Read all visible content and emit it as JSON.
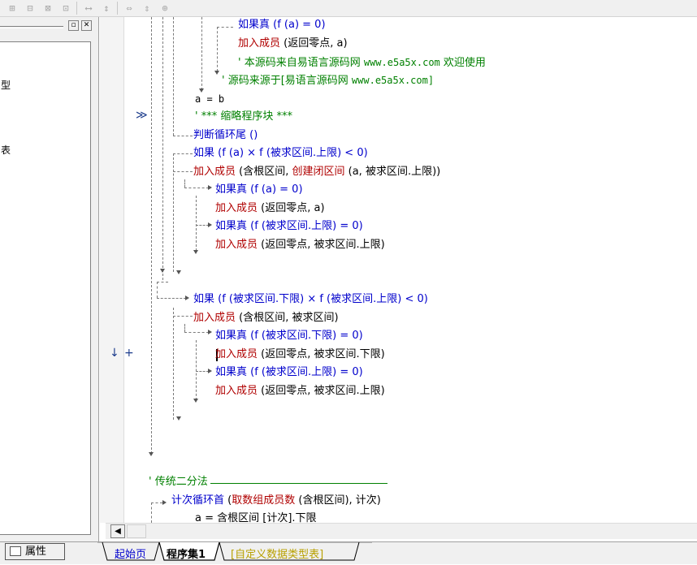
{
  "toolbar": {
    "icons": [
      "align-left-icon",
      "align-center-icon",
      "align-right-icon",
      "align-distribute-icon",
      "space-h-icon",
      "space-v-icon",
      "same-width-icon",
      "same-height-icon",
      "same-size-icon"
    ]
  },
  "left_panel": {
    "tree_fragments": [
      "型",
      "表"
    ]
  },
  "code": {
    "l1": "如果真 (f (a) = 0)",
    "l2a": "加入成员",
    "l2b": " (返回零点, a)",
    "l3a": "' 本源码来自易语言源码网 ",
    "l3b": "www.e5a5x.com",
    "l3c": "  欢迎使用",
    "l4a": "' 源码来源于[易语言源码网 ",
    "l4b": "www.e5a5x.com]",
    "l5": "a = b",
    "l6": "' *** 缩略程序块 ***",
    "l7": "判断循环尾 ()",
    "l8": "如果 (f (a) × f (被求区间.上限) < 0)",
    "l9a": "加入成员",
    "l9b": " (含根区间, ",
    "l9c": "创建闭区间",
    "l9d": " (a, 被求区间.上限))",
    "l10": "如果真 (f (a) = 0)",
    "l11a": "加入成员",
    "l11b": " (返回零点, a)",
    "l12": "如果真 (f (被求区间.上限) = 0)",
    "l13a": "加入成员",
    "l13b": " (返回零点, 被求区间.上限)",
    "l14": "如果 (f (被求区间.下限) × f (被求区间.上限) < 0)",
    "l15a": "加入成员",
    "l15b": " (含根区间, 被求区间)",
    "l16": "如果真 (f (被求区间.下限) = 0)",
    "l17a": "加入成员",
    "l17b": " (返回零点, 被求区间.下限)",
    "l18": "如果真 (f (被求区间.上限) = 0)",
    "l19a": "加入成员",
    "l19b": " (返回零点, 被求区间.上限)",
    "l20": "' 传统二分法",
    "l21a": "计次循环首",
    "l21b": " (",
    "l21c": "取数组成员数",
    "l21d": " (含根区间), 计次)",
    "l22": "a = 含根区间 [计次].下限"
  },
  "gutter": {
    "collapse_marker": "≫",
    "down_marker": "↓",
    "plus_marker": "+"
  },
  "bottom": {
    "properties_label": "属性",
    "tab_start": "起始页",
    "tab_program": "程序集1",
    "tab_custom": "[自定义数据类型表]"
  },
  "colors": {
    "flow_keyword": "#0000cc",
    "command": "#b00000",
    "comment": "#008000"
  }
}
